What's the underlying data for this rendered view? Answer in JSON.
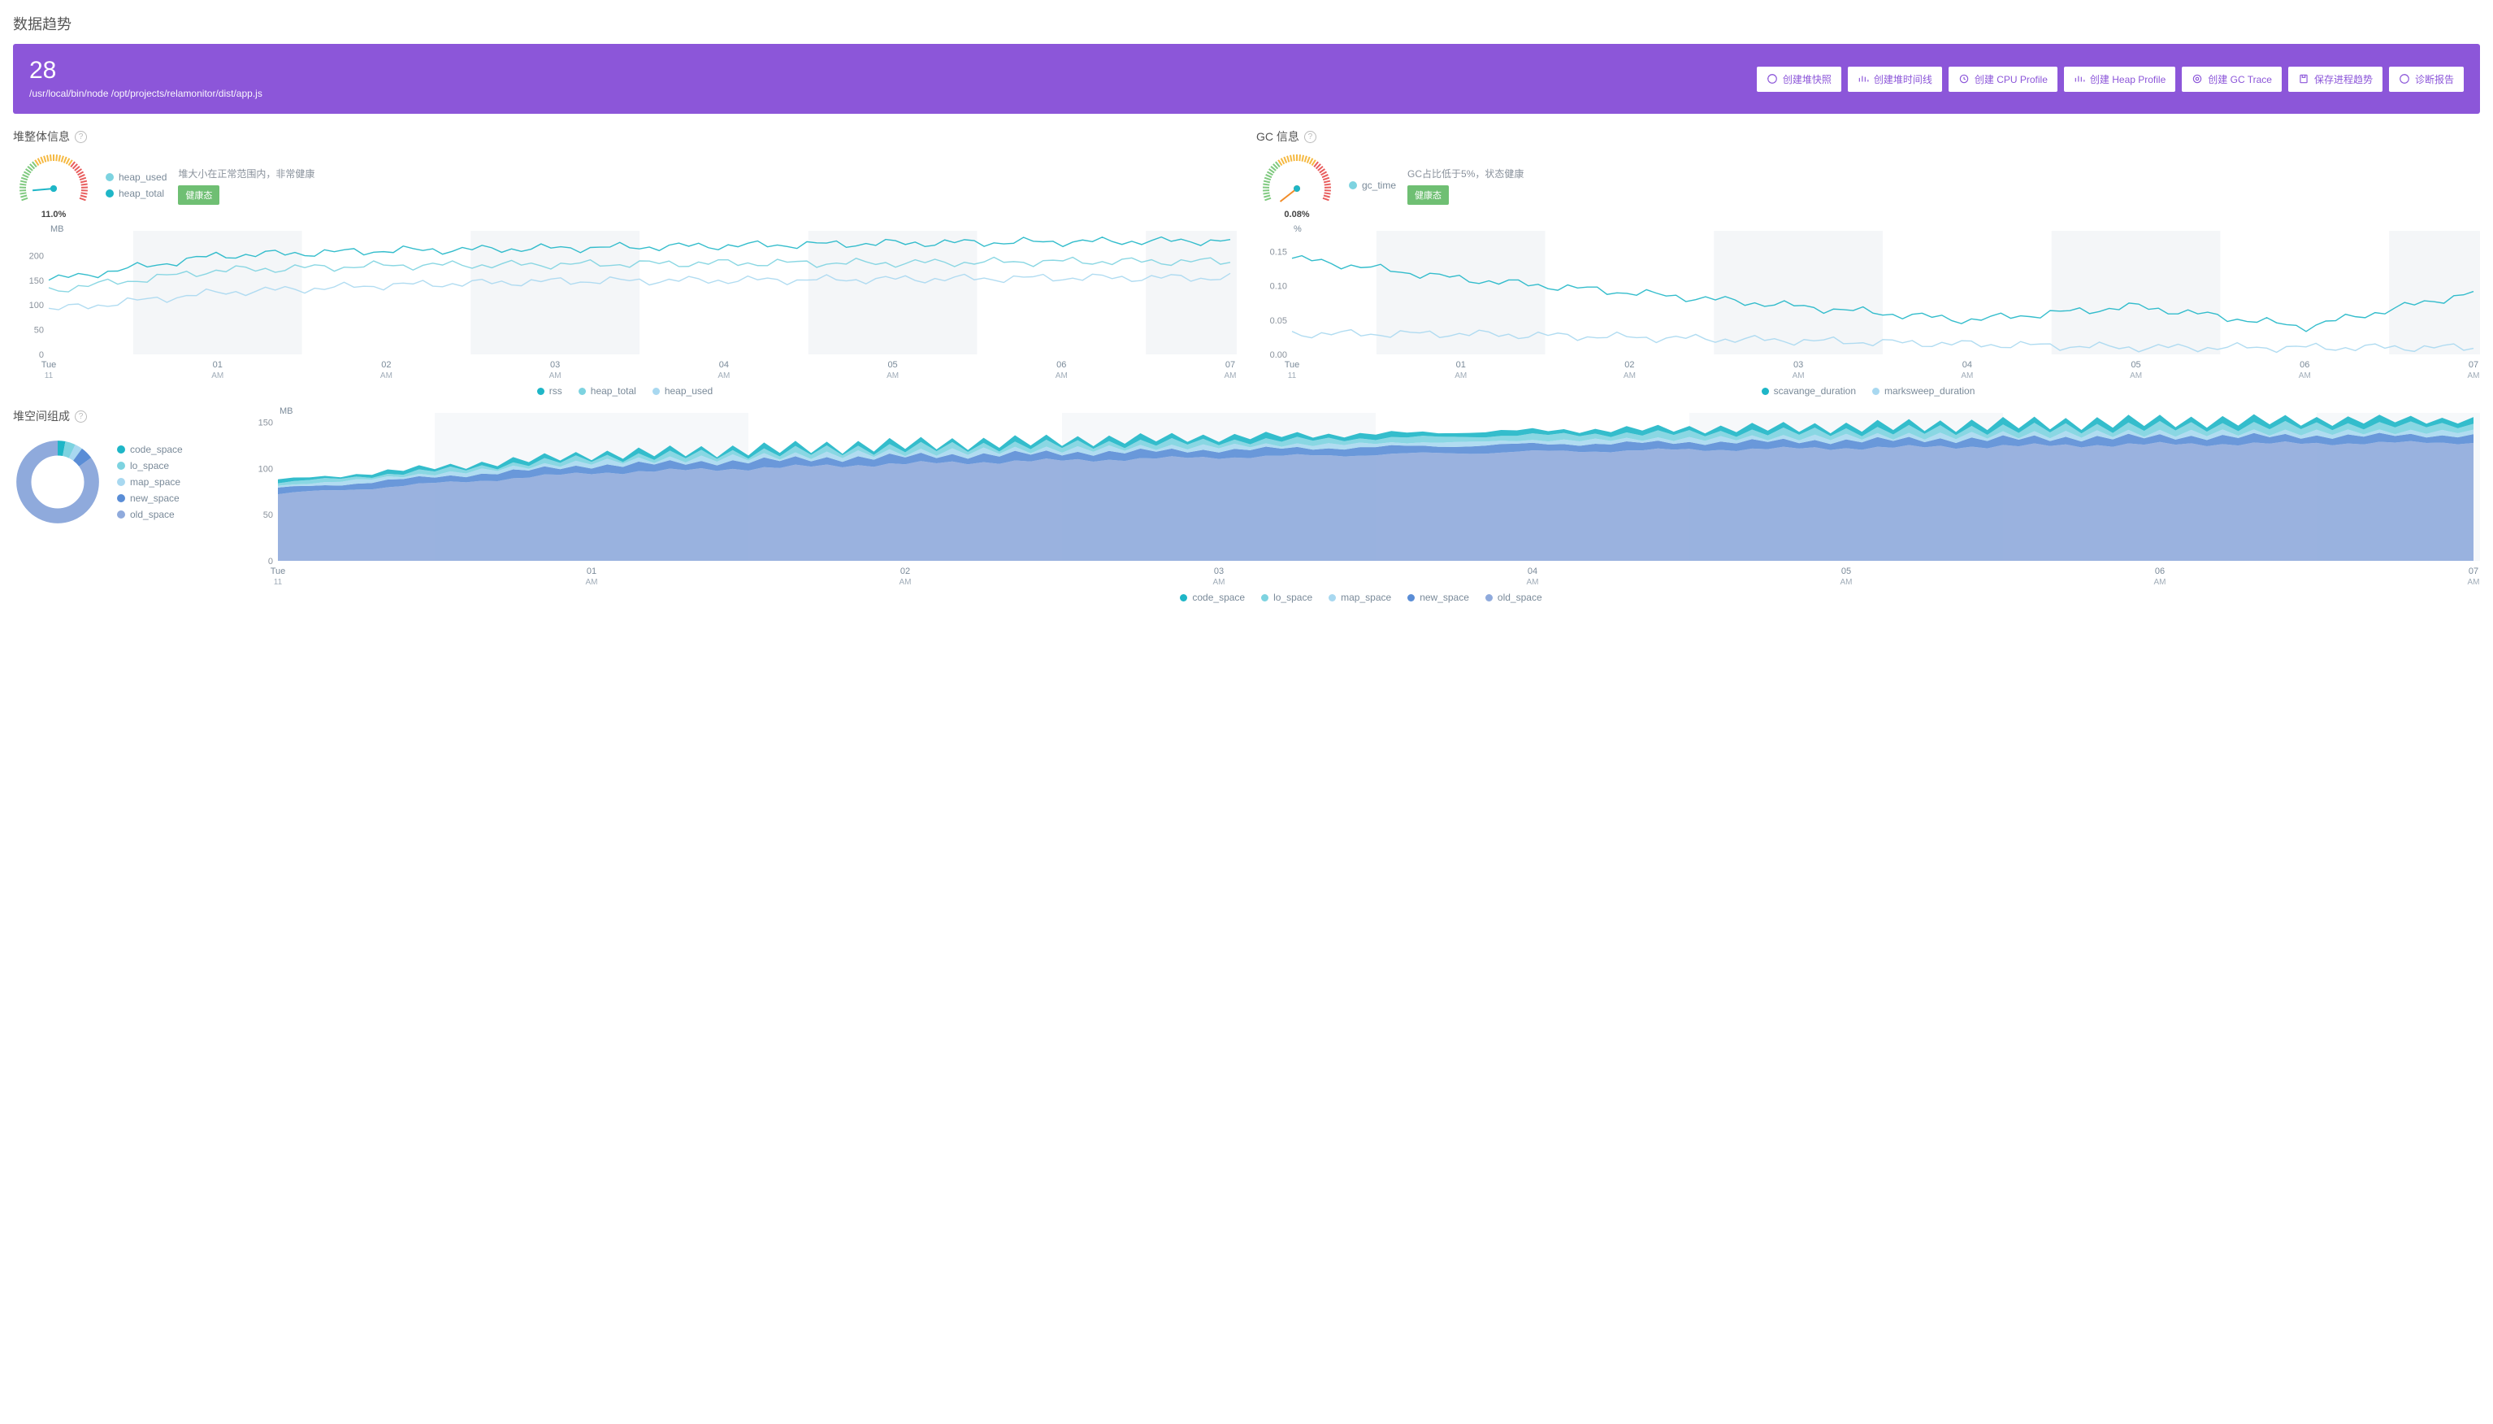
{
  "page_title": "数据趋势",
  "hero": {
    "pid": "28",
    "path": "/usr/local/bin/node /opt/projects/relamonitor/dist/app.js",
    "buttons": [
      "创建堆快照",
      "创建堆时间线",
      "创建 CPU Profile",
      "创建 Heap Profile",
      "创建 GC Trace",
      "保存进程趋势",
      "诊断报告"
    ]
  },
  "heap_panel": {
    "title": "堆整体信息",
    "gauge_value": "11.0%",
    "gauge_color": "#1eb6c7",
    "legend": [
      "heap_used",
      "heap_total"
    ],
    "status_text": "堆大小在正常范围内，非常健康",
    "badge": "健康态"
  },
  "gc_panel": {
    "title": "GC 信息",
    "gauge_value": "0.08%",
    "gauge_color": "#f28c28",
    "legend": [
      "gc_time"
    ],
    "status_text": "GC占比低于5%，状态健康",
    "badge": "健康态"
  },
  "heap_chart": {
    "unit": "MB",
    "legend": [
      "rss",
      "heap_total",
      "heap_used"
    ]
  },
  "gc_chart": {
    "unit": "%",
    "legend": [
      "scavange_duration",
      "marksweep_duration"
    ]
  },
  "space_panel": {
    "title": "堆空间组成",
    "legend": [
      "code_space",
      "lo_space",
      "map_space",
      "new_space",
      "old_space"
    ]
  },
  "space_chart": {
    "unit": "MB",
    "legend": [
      "code_space",
      "lo_space",
      "map_space",
      "new_space",
      "old_space"
    ]
  },
  "x_ticks": [
    {
      "l1": "Tue",
      "l2": "11"
    },
    {
      "l1": "01",
      "l2": "AM"
    },
    {
      "l1": "02",
      "l2": "AM"
    },
    {
      "l1": "03",
      "l2": "AM"
    },
    {
      "l1": "04",
      "l2": "AM"
    },
    {
      "l1": "05",
      "l2": "AM"
    },
    {
      "l1": "06",
      "l2": "AM"
    },
    {
      "l1": "07",
      "l2": "AM"
    }
  ],
  "colors": {
    "c1": "#1eb6c7",
    "c2": "#7dd3e0",
    "c3": "#a8d8f0",
    "c4": "#5a8dd6",
    "c5": "#8faadc",
    "grey": "#e8ecf0"
  },
  "chart_data": [
    {
      "type": "line",
      "title": "堆整体信息",
      "ylabel": "MB",
      "ylim": [
        0,
        250
      ],
      "x_labels": [
        "Tue 11",
        "01 AM",
        "02 AM",
        "03 AM",
        "04 AM",
        "05 AM",
        "06 AM",
        "07 AM"
      ],
      "series": [
        {
          "name": "rss",
          "values": [
            150,
            200,
            210,
            215,
            220,
            225,
            228,
            230
          ]
        },
        {
          "name": "heap_total",
          "values": [
            130,
            170,
            180,
            182,
            185,
            185,
            188,
            188
          ]
        },
        {
          "name": "heap_used",
          "values": [
            90,
            125,
            140,
            148,
            150,
            152,
            155,
            155
          ]
        }
      ]
    },
    {
      "type": "line",
      "title": "GC 信息",
      "ylabel": "%",
      "ylim": [
        0.0,
        0.18
      ],
      "x_labels": [
        "Tue 11",
        "01 AM",
        "02 AM",
        "03 AM",
        "04 AM",
        "05 AM",
        "06 AM",
        "07 AM"
      ],
      "series": [
        {
          "name": "scavange_duration",
          "values": [
            0.14,
            0.11,
            0.09,
            0.07,
            0.05,
            0.07,
            0.04,
            0.09
          ]
        },
        {
          "name": "marksweep_duration",
          "values": [
            0.03,
            0.03,
            0.025,
            0.02,
            0.015,
            0.01,
            0.01,
            0.01
          ]
        }
      ]
    },
    {
      "type": "pie",
      "title": "堆空间组成",
      "series": [
        {
          "name": "code_space",
          "value": 3
        },
        {
          "name": "lo_space",
          "value": 4
        },
        {
          "name": "map_space",
          "value": 3
        },
        {
          "name": "new_space",
          "value": 5
        },
        {
          "name": "old_space",
          "value": 85
        }
      ]
    },
    {
      "type": "area",
      "title": "堆空间组成 (stacked)",
      "ylabel": "MB",
      "ylim": [
        0,
        160
      ],
      "x_labels": [
        "Tue 11",
        "01 AM",
        "02 AM",
        "03 AM",
        "04 AM",
        "05 AM",
        "06 AM",
        "07 AM"
      ],
      "series": [
        {
          "name": "old_space",
          "values": [
            72,
            95,
            105,
            112,
            118,
            122,
            126,
            128
          ]
        },
        {
          "name": "new_space",
          "values": [
            6,
            8,
            8,
            8,
            8,
            8,
            8,
            8
          ]
        },
        {
          "name": "map_space",
          "values": [
            3,
            4,
            4,
            4,
            4,
            4,
            4,
            4
          ]
        },
        {
          "name": "lo_space",
          "values": [
            3,
            4,
            5,
            5,
            6,
            6,
            7,
            7
          ]
        },
        {
          "name": "code_space",
          "values": [
            3,
            4,
            4,
            5,
            5,
            5,
            6,
            6
          ]
        }
      ]
    }
  ]
}
